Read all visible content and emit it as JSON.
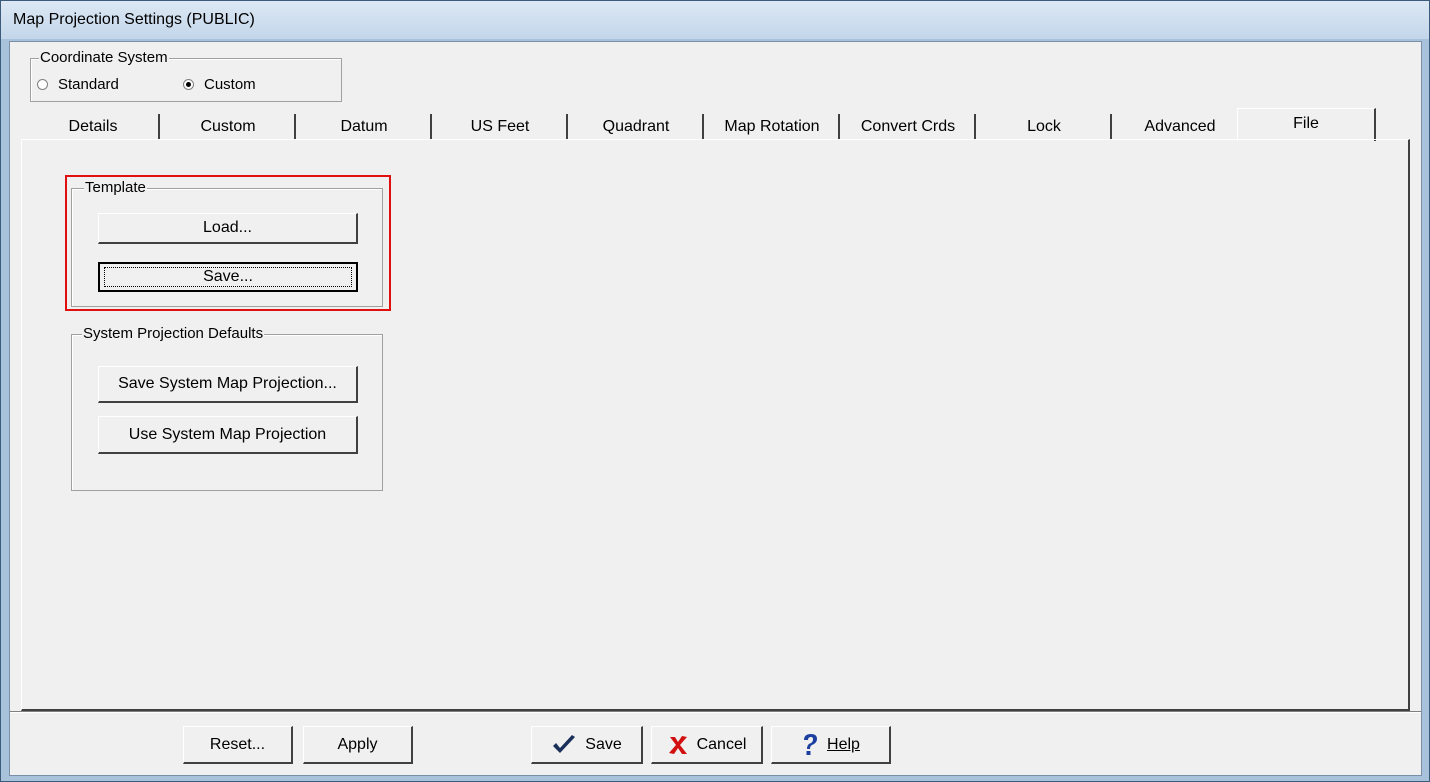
{
  "window": {
    "title": "Map Projection Settings (PUBLIC)"
  },
  "coordinate_system": {
    "label": "Coordinate System",
    "options": [
      {
        "label": "Standard",
        "selected": false
      },
      {
        "label": "Custom",
        "selected": true
      }
    ]
  },
  "tabs": [
    {
      "label": "Details"
    },
    {
      "label": "Custom"
    },
    {
      "label": "Datum"
    },
    {
      "label": "US Feet"
    },
    {
      "label": "Quadrant"
    },
    {
      "label": "Map Rotation"
    },
    {
      "label": "Convert Crds"
    },
    {
      "label": "Lock"
    },
    {
      "label": "Advanced"
    },
    {
      "label": "File",
      "active": true
    }
  ],
  "template_group": {
    "label": "Template",
    "load_label": "Load...",
    "save_label": "Save..."
  },
  "system_defaults_group": {
    "label": "System Projection Defaults",
    "save_system_label": "Save System Map Projection...",
    "use_system_label": "Use System Map Projection"
  },
  "footer": {
    "reset_label": "Reset...",
    "apply_label": "Apply",
    "save_label": "Save",
    "cancel_label": "Cancel",
    "help_label": "Help"
  },
  "colors": {
    "highlight": "#e01010",
    "checkmark": "#1a2f5a",
    "cancel_x": "#d21010",
    "help_icon": "#1d3fa0"
  }
}
